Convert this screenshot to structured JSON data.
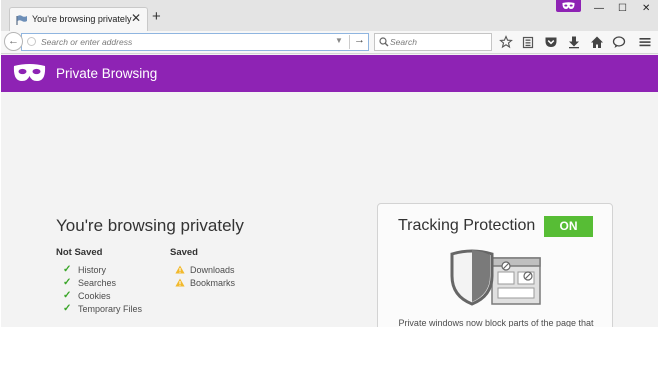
{
  "tab": {
    "title": "You're browsing privately",
    "close": "✕",
    "new_tab": "+"
  },
  "window_controls": {
    "minimize": "—",
    "maximize": "☐",
    "close": "✕"
  },
  "navbar": {
    "back": "←",
    "url_placeholder": "Search or enter address",
    "url_dropmarker": "▼",
    "url_go": "→",
    "search_placeholder": "Search"
  },
  "header": {
    "title": "Private Browsing"
  },
  "main": {
    "heading": "You're browsing privately",
    "not_saved": {
      "title": "Not Saved",
      "items": [
        "History",
        "Searches",
        "Cookies",
        "Temporary Files"
      ]
    },
    "saved": {
      "title": "Saved",
      "items": [
        "Downloads",
        "Bookmarks"
      ]
    }
  },
  "tracking": {
    "title": "Tracking Protection",
    "status": "ON",
    "description": "Private windows now block parts of the page that"
  },
  "colors": {
    "accent": "#8e23b4",
    "on_badge": "#57bd35",
    "check": "#39a527",
    "warning": "#f2b92c"
  }
}
